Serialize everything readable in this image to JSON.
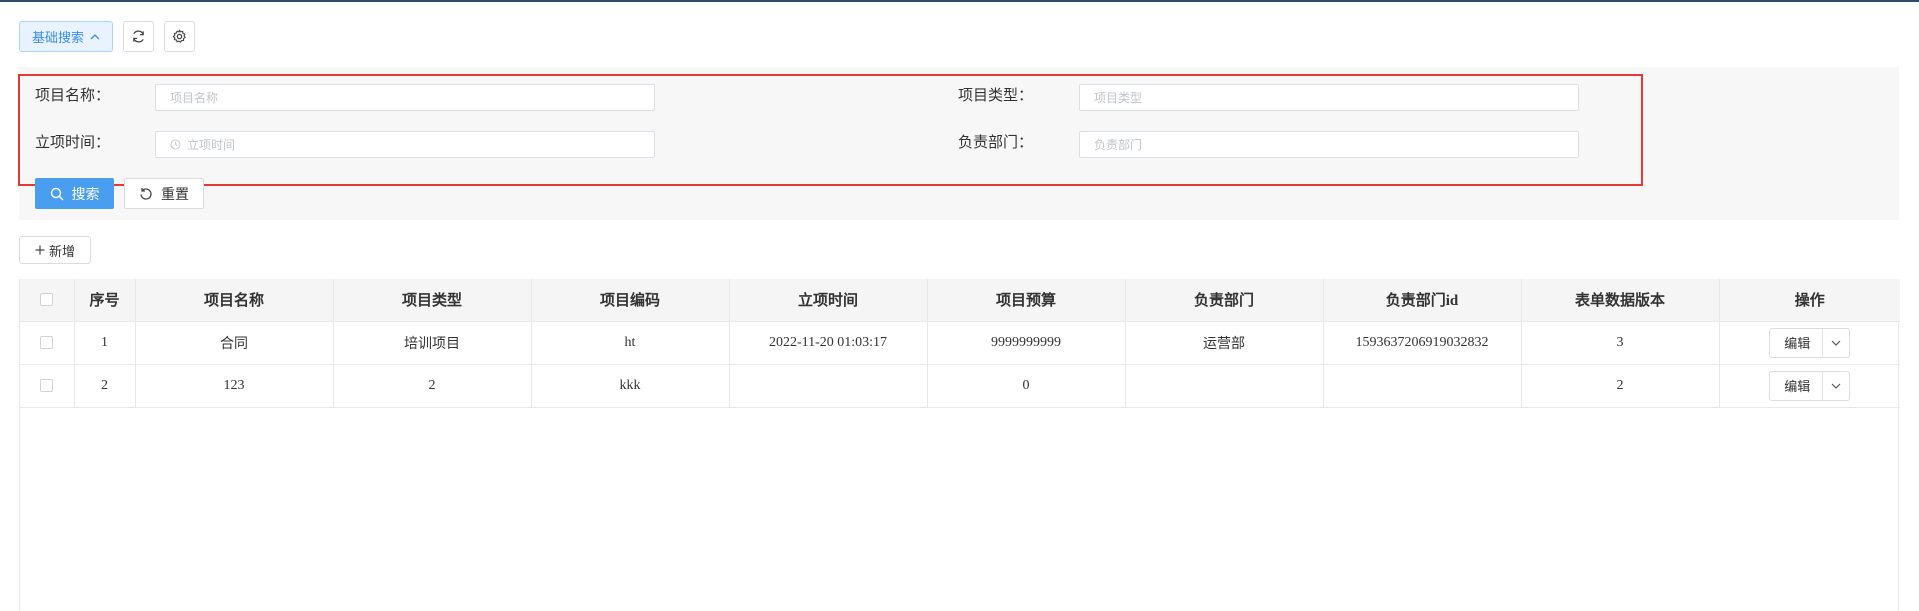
{
  "toolbar": {
    "basic_search_label": "基础搜索"
  },
  "search": {
    "project_name": {
      "label": "项目名称：",
      "placeholder": "项目名称"
    },
    "project_type": {
      "label": "项目类型：",
      "placeholder": "项目类型"
    },
    "start_time": {
      "label": "立项时间：",
      "placeholder": "立项时间"
    },
    "department": {
      "label": "负责部门：",
      "placeholder": "负责部门"
    },
    "search_label": "搜索",
    "reset_label": "重置"
  },
  "actions": {
    "add_label": "新增"
  },
  "table": {
    "headers": [
      "序号",
      "项目名称",
      "项目类型",
      "项目编码",
      "立项时间",
      "项目预算",
      "负责部门",
      "负责部门id",
      "表单数据版本",
      "操作"
    ],
    "rows": [
      {
        "index": "1",
        "name": "合同",
        "type": "培训项目",
        "code": "ht",
        "time": "2022-11-20 01:03:17",
        "budget": "9999999999",
        "dept": "运营部",
        "dept_id": "1593637206919032832",
        "version": "3",
        "op": "编辑"
      },
      {
        "index": "2",
        "name": "123",
        "type": "2",
        "code": "kkk",
        "time": "",
        "budget": "0",
        "dept": "",
        "dept_id": "",
        "version": "2",
        "op": "编辑"
      }
    ]
  },
  "colors": {
    "accent": "#4a9ef0",
    "highlight_border": "#e53935"
  }
}
